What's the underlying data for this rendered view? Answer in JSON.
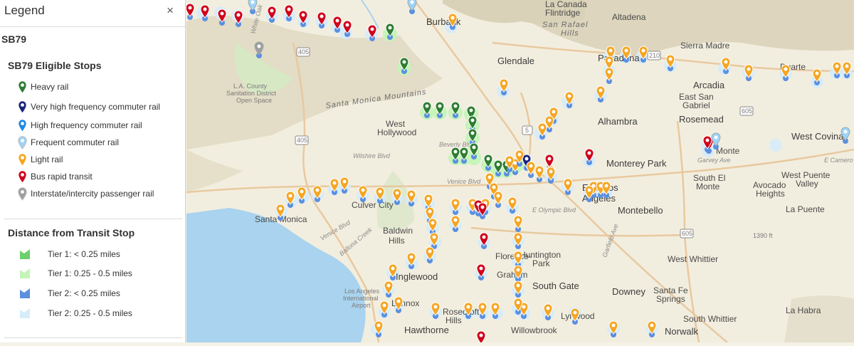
{
  "legend": {
    "title": "Legend",
    "close_label": "×",
    "layer_title": "SB79",
    "stops_title": "SB79 Eligible Stops",
    "stops": [
      {
        "label": "Heavy rail",
        "color": "#2e7d32",
        "icon": "heavy-rail-pin-icon"
      },
      {
        "label": "Very high frequency commuter rail",
        "color": "#1a237e",
        "icon": "very-high-frequency-commuter-rail-pin-icon"
      },
      {
        "label": "High frequency commuter rail",
        "color": "#1e88e5",
        "icon": "high-frequency-commuter-rail-pin-icon"
      },
      {
        "label": "Frequent commuter rail",
        "color": "#9ed3f7",
        "icon": "frequent-commuter-rail-pin-icon"
      },
      {
        "label": "Light rail",
        "color": "#f5a623",
        "icon": "light-rail-pin-icon"
      },
      {
        "label": "Bus rapid transit",
        "color": "#d0021b",
        "icon": "bus-rapid-transit-pin-icon"
      },
      {
        "label": "Interstate/intercity passenger rail",
        "color": "#9e9e9e",
        "icon": "intercity-rail-pin-icon"
      }
    ],
    "distance_title": "Distance from Transit Stop",
    "tiers": [
      {
        "label": "Tier 1: < 0.25 miles",
        "color": "#6ccf6c"
      },
      {
        "label": "Tier 1: 0.25 - 0.5 miles",
        "color": "#c4f5b8"
      },
      {
        "label": "Tier 2: < 0.25 miles",
        "color": "#5b8fe0"
      },
      {
        "label": "Tier 2: 0.25 - 0.5 miles",
        "color": "#d6ecfb"
      }
    ]
  },
  "map": {
    "labels": {
      "burbank": "Burbank",
      "la_canada": "La Canada",
      "flintridge": "Flintridge",
      "altadena": "Altadena",
      "san_rafael": "San Rafael",
      "hills": "Hills",
      "sierra_madre": "Sierra Madre",
      "glendale": "Glendale",
      "pasadena": "Pasadena",
      "duarte": "Duarte",
      "arcadia": "Arcadia",
      "la_county_1": "L.A. County",
      "la_county_2": "Sanitation District",
      "la_county_3": "Open Space",
      "santa_monica_mountains": "Santa Monica Mountains",
      "east_san": "East San",
      "gabriel": "Gabriel",
      "west": "West",
      "hollywood": "Hollywood",
      "alhambra": "Alhambra",
      "rosemead": "Rosemead",
      "el_monte": "Monte",
      "west_covina": "West Covina",
      "beverly_blvd": "Beverly Blvd",
      "wilshire_blvd": "Wilshire Blvd",
      "monterey_park": "Monterey Park",
      "garvey_ave": "Garvey Ave",
      "e_camero": "E Camero",
      "south_el": "South El",
      "monte": "Monte",
      "west_puente": "West Puente",
      "valley": "Valley",
      "avocado": "Avocado",
      "heights": "Heights",
      "venice_blvd": "Venice Blvd",
      "culver_city": "Culver City",
      "east_la_1": "East Los",
      "east_la_2": "Angeles",
      "e_olympic_blvd": "E Olympic Blvd",
      "la_puente": "La Puente",
      "santa_monica": "Santa Monica",
      "venice_blvd_2": "Venice Blvd",
      "baldwin": "Baldwin",
      "baldwin_hills": "Hills",
      "montebello": "Montebello",
      "ballona": "Ballona Creek",
      "huntington": "Huntington",
      "park": "Park",
      "florence": "Florence-",
      "graham": "Graham",
      "west_whittier": "West Whittier",
      "inglewood": "Inglewood",
      "south_gate": "South Gate",
      "downey": "Downey",
      "santa_fe": "Santa Fe",
      "springs": "Springs",
      "lax_1": "Los Angeles",
      "lax_2": "International",
      "lax_3": "Airport",
      "lennox": "Lennox",
      "south_whittier": "South Whittier",
      "la_habra": "La Habra",
      "roseville": "Rosecroft",
      "hills2": "Hills",
      "lynwood": "Lynwood",
      "hawthorne": "Hawthorne",
      "willowbrook": "Willowbrook",
      "norwalk": "Norwalk",
      "white_oak": "White Oak",
      "garfield": "Garfield Ave",
      "elev": "1390 ft",
      "i405a": "405",
      "i405b": "405",
      "i405c": "405",
      "i5": "5",
      "i605a": "605",
      "i605b": "605",
      "r210": "210"
    }
  }
}
